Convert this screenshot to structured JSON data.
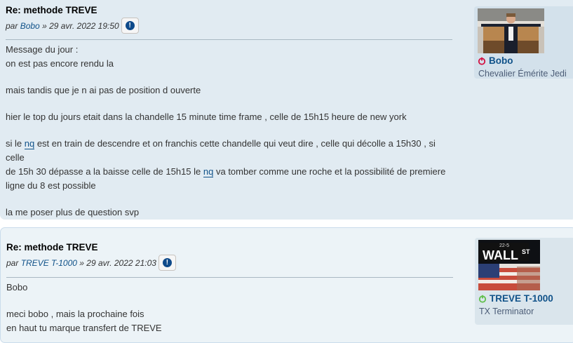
{
  "posts": [
    {
      "title": "Re: methode TREVE",
      "by": "par",
      "author": "Bobo",
      "date": "» 29 avr. 2022 19:50",
      "report_icon": "report-icon",
      "lines": {
        "l1": "Message du jour :",
        "l2": "on est pas encore rendu la",
        "l3": "mais tandis que je n ai pas de position d ouverte",
        "l4": "hier le top du jours etait dans la chandelle 15 minute time frame , celle de 15h15 heure de new york",
        "l5a": "si le ",
        "l5k": "nq",
        "l5b": " est en train de descendre et on franchis cette chandelle qui veut dire , celle qui décolle a 15h30 , si celle",
        "l6a": "de 15h 30 dépasse a la baisse celle de 15h15 le ",
        "l6k": "nq",
        "l6b": " va tomber comme une roche et la possibilité de premiere",
        "l7": "ligne du 8 est possible",
        "l8": "la me poser plus de question svp"
      },
      "profile": {
        "username": "Bobo",
        "rank": "Chevalier Émérite Jedi",
        "status": "offline",
        "status_color": "#d31141"
      }
    },
    {
      "title": "Re: methode TREVE",
      "by": "par",
      "author": "TREVE T-1000",
      "date": "» 29 avr. 2022 21:03",
      "report_icon": "report-icon",
      "lines": {
        "l1": "Bobo",
        "l2": "meci bobo , mais la prochaine fois",
        "l3": "en haut tu marque transfert de TREVE"
      },
      "profile": {
        "username": "TREVE T-1000",
        "rank": "TX Terminator",
        "status": "online",
        "status_color": "#5fbf4a",
        "avatar_sign": "WALL",
        "avatar_sign_suffix": "ST",
        "avatar_sign_number": "22-5"
      }
    }
  ]
}
